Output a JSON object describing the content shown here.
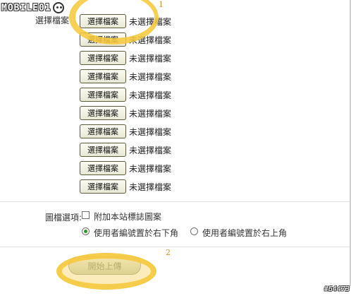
{
  "logo": {
    "text": "MOBILE01"
  },
  "file_section": {
    "label": "選擇檔案",
    "rows": [
      {
        "button": "選擇檔案",
        "status": "未選擇檔案"
      },
      {
        "button": "選擇檔案",
        "status": "未選擇檔案"
      },
      {
        "button": "選擇檔案",
        "status": "未選擇檔案"
      },
      {
        "button": "選擇檔案",
        "status": "未選擇檔案"
      },
      {
        "button": "選擇檔案",
        "status": "未選擇檔案"
      },
      {
        "button": "選擇檔案",
        "status": "未選擇檔案"
      },
      {
        "button": "選擇檔案",
        "status": "未選擇檔案"
      },
      {
        "button": "選擇檔案",
        "status": "未選擇檔案"
      },
      {
        "button": "選擇檔案",
        "status": "未選擇檔案"
      },
      {
        "button": "選擇檔案",
        "status": "未選擇檔案"
      }
    ]
  },
  "options": {
    "label": "圖檔選項:",
    "checkbox_label": "附加本站標誌圖案",
    "checkbox_checked": false,
    "radios": [
      {
        "label": "使用者編號置於右下角",
        "checked": true
      },
      {
        "label": "使用者編號置於右上角",
        "checked": false
      }
    ]
  },
  "upload": {
    "label": "開始上傳"
  },
  "annotations": {
    "marker_1": "1",
    "marker_2": "2",
    "highlight_color": "#f6c83c"
  },
  "watermark": "#64473"
}
